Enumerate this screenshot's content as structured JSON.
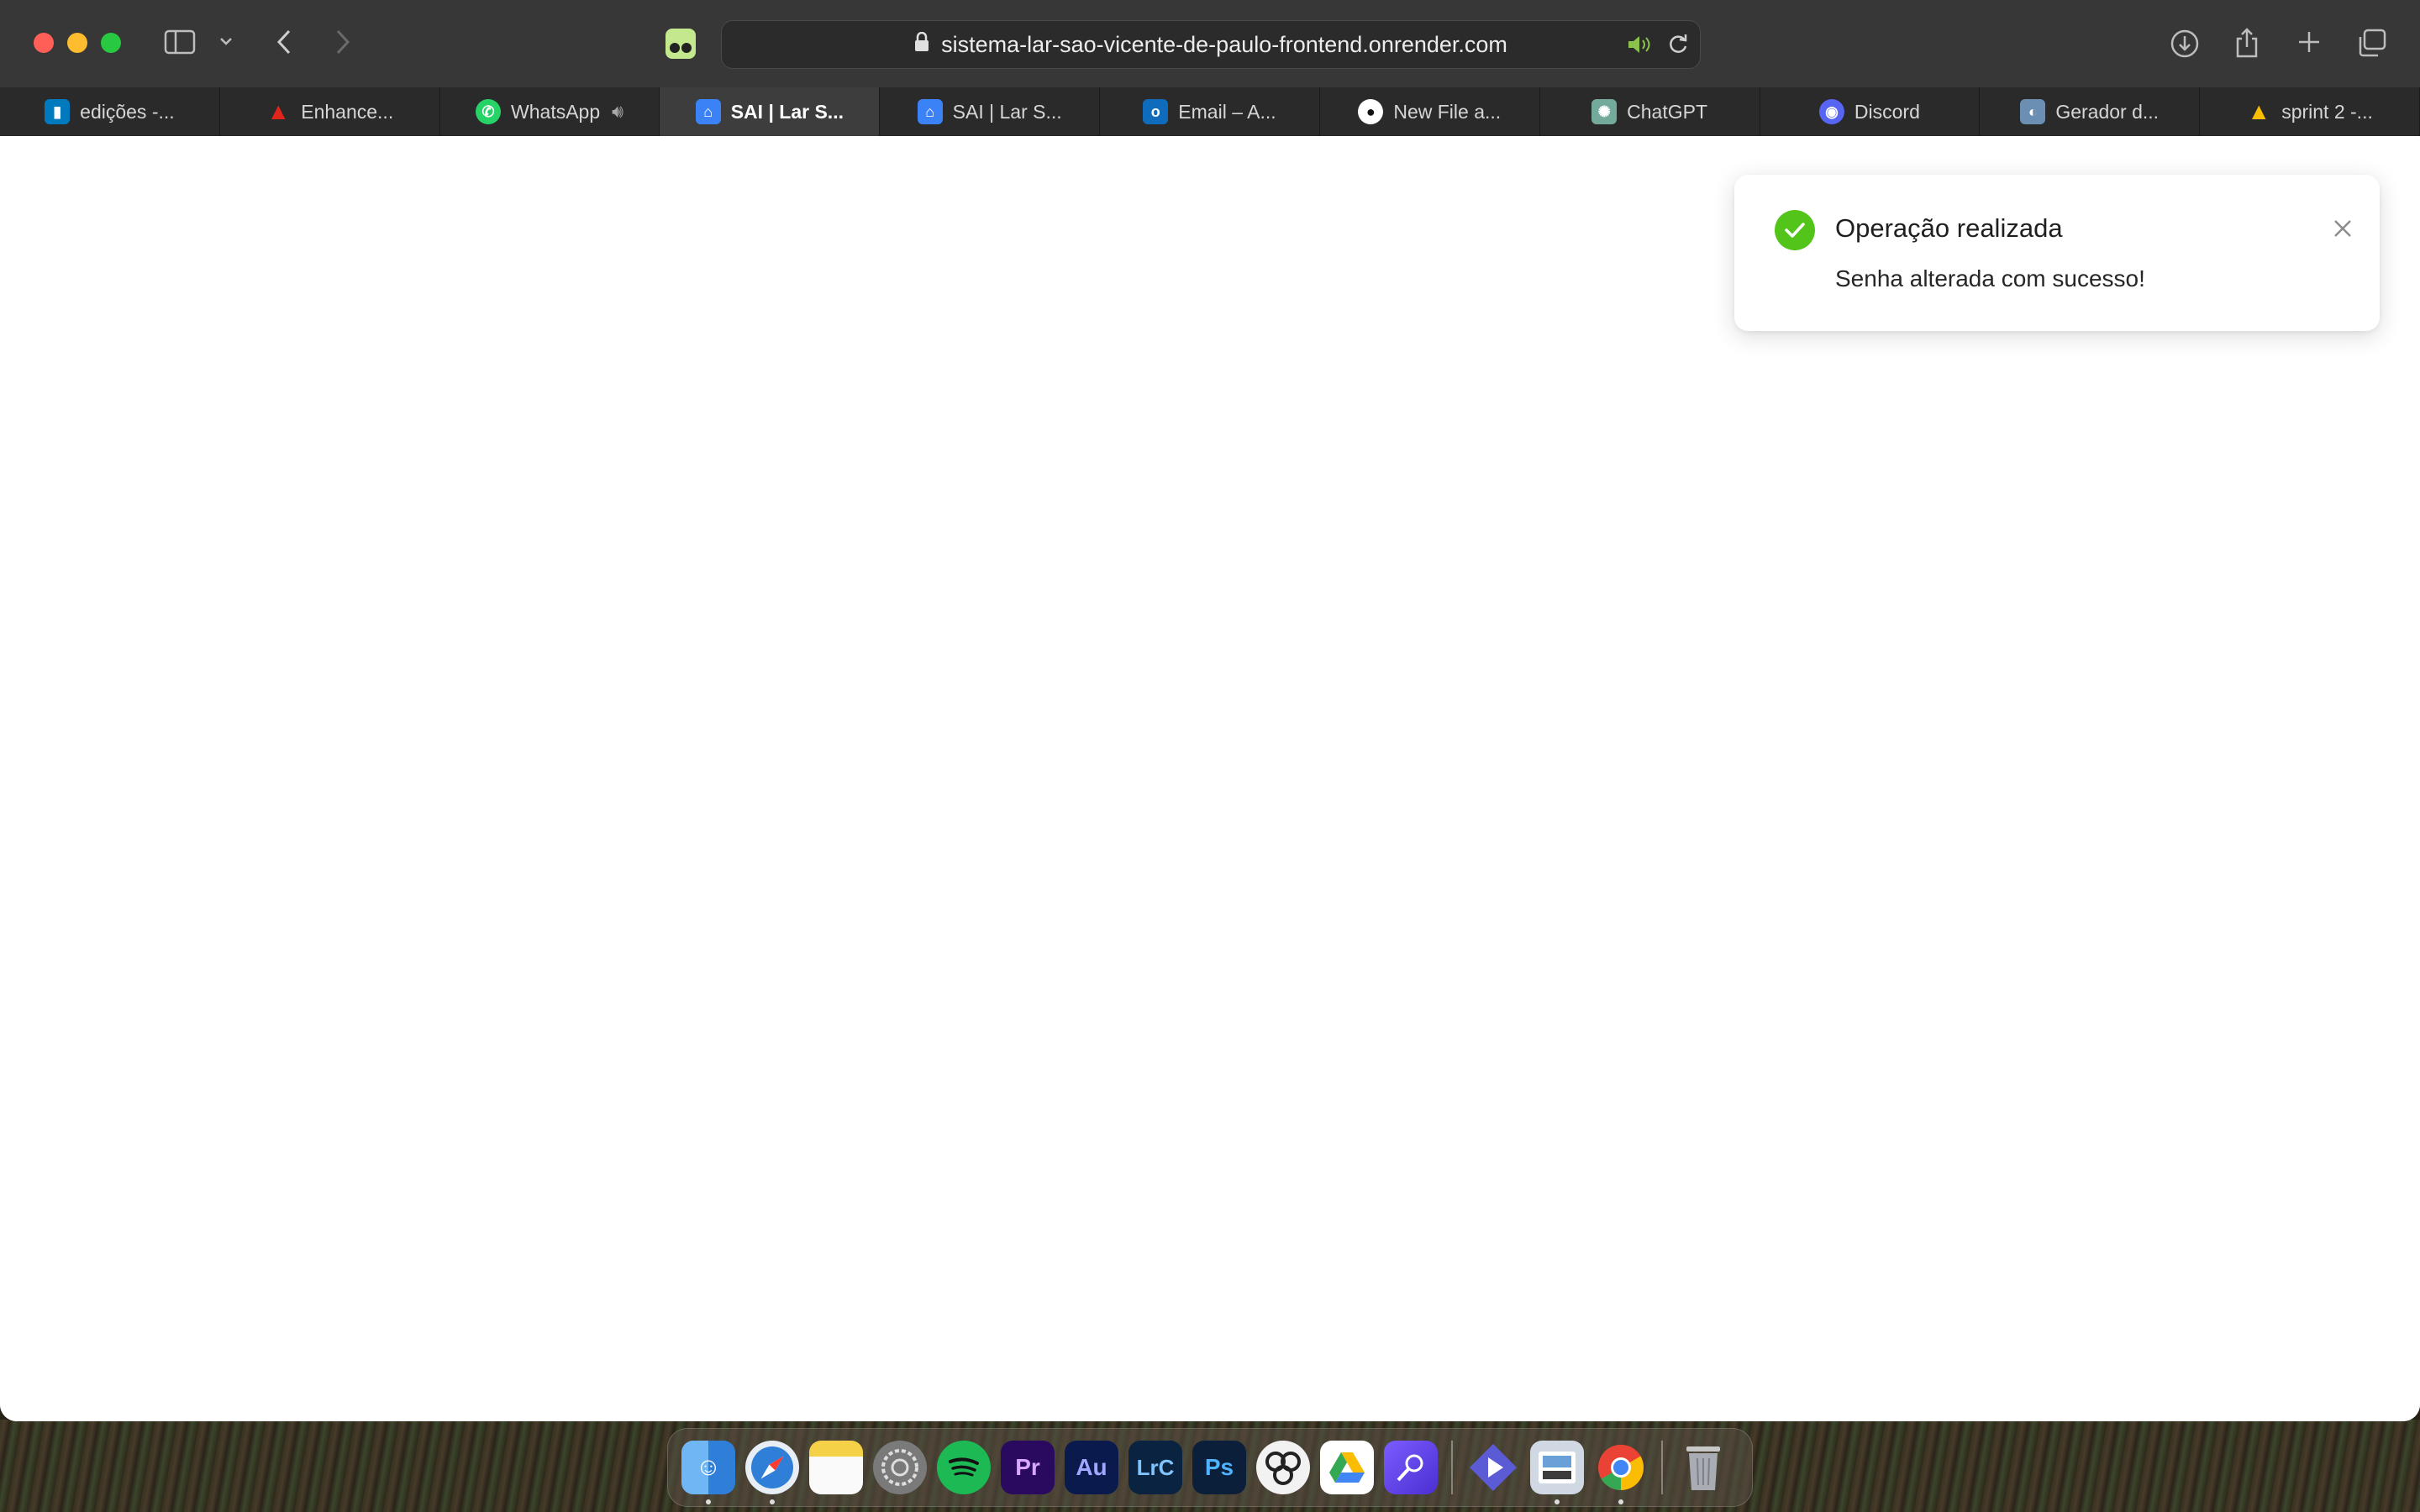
{
  "browser": {
    "url": "sistema-lar-sao-vicente-de-paulo-frontend.onrender.com"
  },
  "tabs": [
    {
      "label": "edições -...",
      "icon": "trello-icon",
      "color": "#0079bf"
    },
    {
      "label": "Enhance...",
      "icon": "adobe-icon",
      "color": "#e1251b"
    },
    {
      "label": "WhatsApp",
      "icon": "whatsapp-icon",
      "color": "#25d366"
    },
    {
      "label": "SAI | Lar S...",
      "icon": "sai-icon",
      "color": "#3b82f6"
    },
    {
      "label": "SAI | Lar S...",
      "icon": "sai-icon",
      "color": "#3b82f6"
    },
    {
      "label": "Email – A...",
      "icon": "outlook-icon",
      "color": "#0f6cbd"
    },
    {
      "label": "New File a...",
      "icon": "github-icon",
      "color": "#ffffff"
    },
    {
      "label": "ChatGPT",
      "icon": "chatgpt-icon",
      "color": "#74aa9c"
    },
    {
      "label": "Discord",
      "icon": "discord-icon",
      "color": "#5865f2"
    },
    {
      "label": "Gerador d...",
      "icon": "gerador-icon",
      "color": "#6b8fb3"
    },
    {
      "label": "sprint 2 -...",
      "icon": "google-drive-icon",
      "color": "#fbbc04"
    }
  ],
  "toast": {
    "title": "Operação realizada",
    "message": "Senha alterada com sucesso!",
    "status_color": "#52c41a"
  },
  "dock": [
    {
      "name": "finder-icon",
      "glyph": "",
      "color": "#3a8ee6"
    },
    {
      "name": "safari-icon",
      "glyph": "",
      "color": "#2f7fd9"
    },
    {
      "name": "notes-icon",
      "glyph": "",
      "color": "#f5d147"
    },
    {
      "name": "system-settings-icon",
      "glyph": "",
      "color": "#7a7a7a"
    },
    {
      "name": "spotify-icon",
      "glyph": "",
      "color": "#1db954"
    },
    {
      "name": "premiere-pro-icon",
      "glyph": "Pr",
      "color": "#2a0a5e"
    },
    {
      "name": "audition-icon",
      "glyph": "Au",
      "color": "#0b1a4d"
    },
    {
      "name": "lightroom-classic-icon",
      "glyph": "LrC",
      "color": "#0a2340"
    },
    {
      "name": "photoshop-icon",
      "glyph": "Ps",
      "color": "#0b1f3a"
    },
    {
      "name": "davinci-resolve-icon",
      "glyph": "",
      "color": "#2b2b2b"
    },
    {
      "name": "google-drive-icon",
      "glyph": "",
      "color": "#ffffff"
    },
    {
      "name": "instruments-icon",
      "glyph": "",
      "color": "#6b4de6"
    },
    {
      "name": "linear-icon",
      "glyph": "",
      "color": "#5b5bd6"
    },
    {
      "name": "preview-icon",
      "glyph": "",
      "color": "#cfd8e3"
    },
    {
      "name": "chrome-icon",
      "glyph": "",
      "color": "#ea4335"
    },
    {
      "name": "trash-icon",
      "glyph": "",
      "color": "#9aa0a6"
    }
  ]
}
